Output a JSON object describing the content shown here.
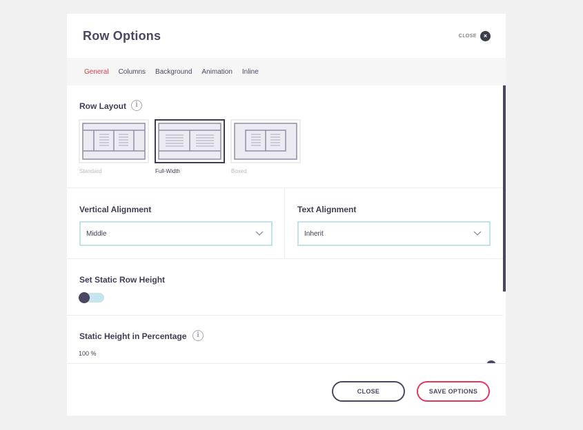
{
  "modal": {
    "title": "Row Options",
    "close_label": "CLOSE",
    "close_icon": "×"
  },
  "tabs": [
    {
      "label": "General",
      "active": true
    },
    {
      "label": "Columns"
    },
    {
      "label": "Background"
    },
    {
      "label": "Animation"
    },
    {
      "label": "Inline"
    }
  ],
  "row_layout": {
    "label": "Row Layout",
    "info_icon": "i",
    "options": [
      {
        "label": "Standard"
      },
      {
        "label": "Full-Width",
        "selected": true
      },
      {
        "label": "Boxed"
      }
    ]
  },
  "vertical_alignment": {
    "label": "Vertical Alignment",
    "value": "Middle"
  },
  "text_alignment": {
    "label": "Text Alignment",
    "value": "Inherit"
  },
  "static_row_height": {
    "label": "Set Static Row Height",
    "enabled": false
  },
  "static_height_percentage": {
    "label": "Static Height in Percentage",
    "info_icon": "i",
    "value": "100 %"
  },
  "footer": {
    "close_label": "CLOSE",
    "save_label": "SAVE OPTIONS"
  },
  "colors": {
    "accent": "#e0394f",
    "primary": "#4a4763",
    "select_border": "#bfe3ea",
    "toggle_track": "#c6e5f1"
  }
}
